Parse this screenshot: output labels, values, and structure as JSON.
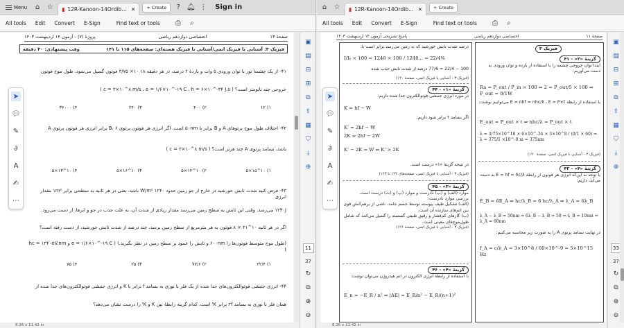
{
  "left": {
    "titlebar": {
      "menu_label": "Menu",
      "tab_title": "12R-Kanoon-14Ordibehe...",
      "create_label": "Create",
      "signin_label": "Sign in"
    },
    "toolbar": {
      "all_tools": "All tools",
      "edit": "Edit",
      "convert": "Convert",
      "esign": "E-Sign",
      "find": "Find text or tools"
    },
    "rail": {
      "page_current": "11",
      "page_total": "37"
    },
    "status": "8.26 x 11.42 in",
    "doc": {
      "header_right": "پروژهٔ (۷) - آزمون ۱۴ اردیبهشت ۱۴۰۳",
      "header_mid": "اختصاصی دوازدهم ریاضی",
      "header_left": "صفحهٔ ۱۳",
      "topic": "فیزیک ۳: آشنایی با فیزیک اتمی/آشنایی با فیزیک هسته‌ای: صفحه‌های ۱۱۵ تا ۱۴۱",
      "topic_time": "وقت پیشنهادی: ۳۰ دقیقه",
      "q41": "۴۱- از یک چشمهٔ نور با توان ورودی ۵ وات و بازدهٔ ۲ درصد، در هر دقیقه ۱۸ ۱۰× ۳/۷۵ فوتون گسیل می‌شود. طول موج فوتون",
      "q41b": "خروجی چند نانومتر است؟ ( c = ۳×۱۰^۸ m/s ، e = ۱/۶×۱۰^-۱۹ C ، h = ۶×۱۰^-۳۴ J.s )",
      "q41_choices": [
        "۱) ۱۲",
        "۲) ۴۰۰",
        "۳) ۲۴۰",
        "۴) ۳۶۰۰۰"
      ],
      "q42": "۴۲- اختلاف طول موج پرتوهای A و B برابر با ۵۰nm است. اگر انرژی هر فوتون پرتوی B، ۶ برابر انرژی هر فوتون پرتوی A",
      "q42b": "باشد، بسامد پرتوی A چند هرتز است؟ ( c = ۳×۱۰^۸ m/s )",
      "q42_choices": [
        "۱) ۱۰^۱۵×۵",
        "۲) ۱۰^۱۴×۵",
        "۳) ۱۰^۱۶×۵",
        "۴) ۱۰^۱۳×۵"
      ],
      "q43": "۴۳- فرض کنید شدت تابش خورشید در خارج از جو زمین حدود ۱۲۴۰ W/m² باشد، یعنی در هر ثانیه به سطحی برابر ۱m² مقدار انرژی",
      "q43b": "۱۲۴۰J می‌رسد. وقتی این تابش به سطح زمین می‌رسد مقدار زیادی از شدت آن، به علت جذب در جو و ابرها، از دست می‌رود.",
      "q43c": "اگر در هر ثانیه ۱۰^۲۱ × ۸ فوتون به هر مترمربع از سطح زمین برسد، چند درصد از شدت تابش خورشید، از دست رفته است؟",
      "q43d": "(طول موج متوسط فوتون‌ها را ۶۰۰nm و تابش را عمود بر سطح زمین در نظر بگیرید.) ( e = ۱/۶×۱۰^-۱۹ C و hc = ۱۲۴۰eV.nm )",
      "q43_choices": [
        "۱) ۲۲/۴",
        "۲) ۷۷/۶",
        "۳) ۲۵",
        "۴) ۷۵"
      ],
      "q44": "۴۴- انرژی جنبشی فوتوالکترون‌های جدا شده از یک فلز با نوری به بسامد f برابر با K و انرژی جنبشی فوتوالکترون‌های جدا شده از",
      "q44b": "همان فلز با نوری به بسامد ۲f برابر K' است. کدام گزینه رابطهٔ بین K و K' را درست نشان می‌دهد؟"
    }
  },
  "right": {
    "titlebar": {
      "tab_title": "12R-Kanoon-14Ordibehe...",
      "create_label": "Create"
    },
    "toolbar": {
      "all_tools": "All tools",
      "edit": "Edit",
      "convert": "Convert",
      "esign": "E-Sign",
      "find": "Find text or tools"
    },
    "rail": {
      "page_current": "33",
      "page_total": "37"
    },
    "status": "8.26 x 11.42 in",
    "doc": {
      "header_right": "پاسخ تشریحی آزمون ۱۴ اردیبهشت ۱۴۰۳",
      "header_mid": "اختصاصی دوازدهم ریاضی",
      "header_left": "صفحهٔ ۱۱",
      "col_right_title": "فیزیک ۳",
      "a41_tag": "گزینهٔ «۲» - ۴۱",
      "a41_text": "ابتدا توان خروجی چشمه را با استفاده از بازده و توان ورودی به دست می‌آوریم:",
      "a41_f1": "Ra = P_out / P_in × 100 ⇒ 2 = P_out/5 × 100 ⇒ P_out = 0/1W",
      "a41_text2": "با استفاده از رابطهٔ E = nhf = nhc/λ ، E = P×t می‌توانیم نوشت:",
      "a41_f2": "E_out = P_out × t ⇒ nhc/λ = P_out × t",
      "a41_f3": "λ = 3/75×10^18 × 6×10^-34 × 3×10^8 / (0/1 × 60) ⇒ λ = 375/1 ×10^-9 m = 375nm",
      "a41_ref": "(فیزیک ۳ - آشنایی با فیزیک اتمی، صفحهٔ ۱۲۰)",
      "a42_tag": "گزینهٔ «۴» - ۴۲",
      "a42_text": "با توجه به این‌که انرژی هر فوتون از رابطهٔ E = hf = hc/λ به دست می‌آید، داریم:",
      "a42_f1": "E_B = 6E_A ⇒ hc/λ_B = 6 hc/λ_A ⇒ λ_A = 6λ_B",
      "a42_f2": "λ_A − λ_B = 50nm ⇒ 6λ_B − λ_B = 50 ⇒ λ_B = 10nm ⇒ λ_A = 60nm",
      "a42_text2": "در نهایت بسامد پرتوی A را به صورت زیر محاسبه می‌کنیم:",
      "a42_f3": "f_A = c/λ_A = 3×10^8 / 60×10^-9 = 5×10^15 Hz",
      "col_left_top": "درصد شدت تابش خورشید که به زمین می‌رسد برابر است با:",
      "a43_f1": "I/I₀ × 100 = 1240 × 100 / 1240... = 22/4%",
      "a43_f2": "100 − 22/4 = 77/6 درصد از شدت تابش جذب شده",
      "a43_ref": "(فیزیک ۳ - آشنایی با فیزیک اتمی، صفحهٔ ۱۲۰)",
      "a44_tag": "گزینهٔ «۱» - ۴۴",
      "a44_text": "در مورد انرژی جنبشی فوتوالکترون جدا شده داریم:",
      "a44_f1": "K = hf − W",
      "a44_text2": "اگر بسامد ۲ برابر شود داریم:",
      "a44_f2": "K' = 2hf − W",
      "a44_f3": "2K = 2hf − 2W",
      "a44_f4": "K' − 2K = W ⇒ K' > 2K",
      "a44_text3": "در نتیجه گزینهٔ «۱» درست است.",
      "a44_ref": "(فیزیک ۳ - آشنایی با فیزیک اتمی، صفحه‌های ۱۲۲ تا ۱۲۳)",
      "a45_tag": "گزینهٔ «۳» - ۴۵",
      "a45_text": "موارد (الف) و (ب) نادرست و موارد (پ) و (ت) درست است.",
      "a45_text2": "بررسی موارد نادرست:",
      "a45_text3": "(الف) تشکیل طیف پیوسته توسط جسم جامد، ناشی از برهم‌کنش قوی بین اتم‌های سازنده آن است.",
      "a45_text4": "(ب) گازهای کم‌فشار و رقیق طیفی گسسته را گسیل می‌کنند که شامل طول‌موج‌های معینی است.",
      "a45_ref": "(فیزیک ۳ - آشنایی با فیزیک اتمی، صفحهٔ ۱۲۶)",
      "a46_tag": "گزینهٔ «۴» - ۴۶",
      "a46_text": "با استفاده از رابطهٔ انرژی الکترون در اتم هیدروژن می‌توان نوشت:",
      "a46_f1": "E_n = −E_R / n² ⇒ |ΔE| = E_R/n² − E_R/(n+1)²"
    }
  }
}
